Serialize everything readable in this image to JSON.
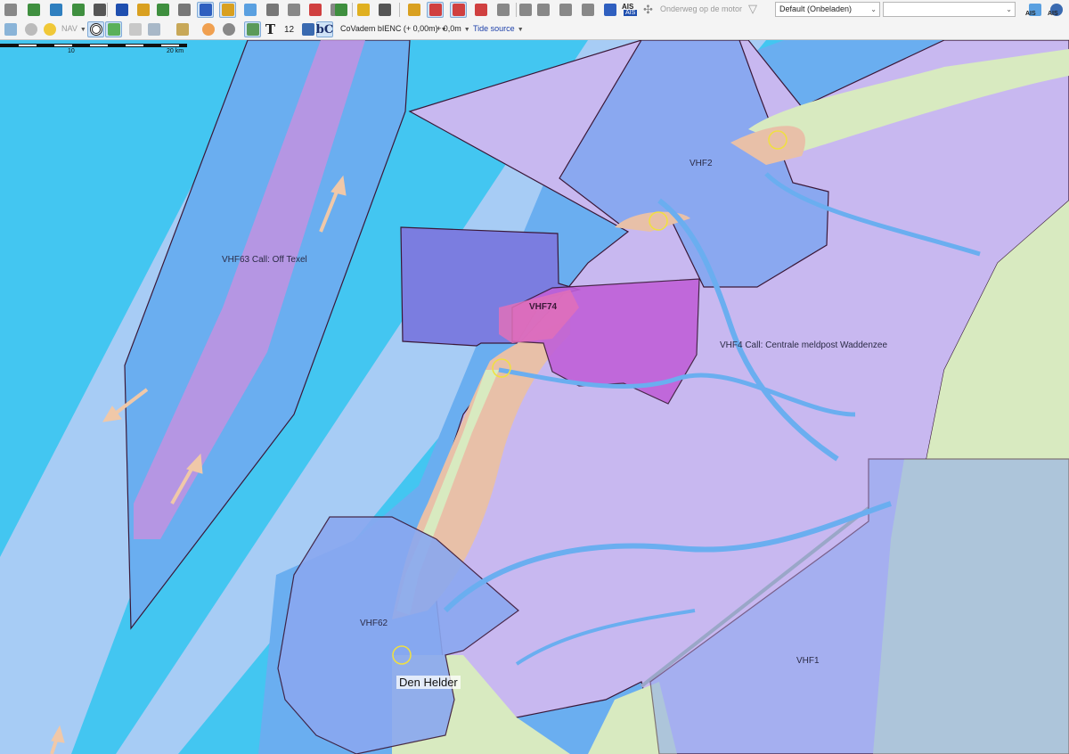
{
  "toolbar": {
    "row1_buttons": [
      {
        "name": "tools-icon",
        "color": "#888888",
        "active": false
      },
      {
        "name": "route-icon",
        "color": "#3f8f3f",
        "active": false
      },
      {
        "name": "link-icon",
        "color": "#2f7fbf",
        "active": false
      },
      {
        "name": "waypoint-icon",
        "color": "#3f8f3f",
        "active": false
      },
      {
        "name": "start-icon",
        "color": "#555555",
        "active": false
      },
      {
        "name": "xpl-icon",
        "color": "#1f4faf",
        "active": false
      },
      {
        "name": "star-icon",
        "color": "#d9a020",
        "active": false
      },
      {
        "name": "chart-icon",
        "color": "#3f8f3f",
        "active": false
      },
      {
        "name": "pen-icon",
        "color": "#777777",
        "active": false
      },
      {
        "name": "target-icon",
        "color": "#2f5fbf",
        "active": true
      },
      {
        "name": "tag-icon",
        "color": "#d9a020",
        "active": true
      },
      {
        "name": "mark-icon",
        "color": "#5aa0e0",
        "active": false
      },
      {
        "name": "edit-icon",
        "color": "#777777",
        "active": false
      },
      {
        "name": "layers-icon",
        "color": "#888888",
        "active": false
      },
      {
        "name": "pin-icon",
        "color": "#d04040",
        "active": false
      },
      {
        "name": "tag2-icon",
        "color": "#888888",
        "active": false
      },
      {
        "name": "grid-icon",
        "color": "#3f8f3f",
        "active": false
      },
      {
        "name": "warning-icon",
        "color": "#e0b020",
        "active": false
      },
      {
        "name": "steer-icon",
        "color": "#555555",
        "active": false
      },
      {
        "name": "traffic-icon",
        "color": "#d9a020",
        "active": false
      },
      {
        "name": "highlight-icon",
        "color": "#d04040",
        "active": true
      },
      {
        "name": "frame-icon",
        "color": "#d04040",
        "active": true
      },
      {
        "name": "flag-icon",
        "color": "#d04040",
        "active": false
      },
      {
        "name": "screen-icon",
        "color": "#888888",
        "active": false
      },
      {
        "name": "moon-icon",
        "color": "#888888",
        "active": false
      },
      {
        "name": "sound-icon",
        "color": "#888888",
        "active": false
      },
      {
        "name": "wrench-icon",
        "color": "#888888",
        "active": false
      },
      {
        "name": "search-icon",
        "color": "#888888",
        "active": false
      },
      {
        "name": "help-icon",
        "color": "#2f5fbf",
        "active": false
      }
    ],
    "ais_label": "AIS",
    "ais_sub": "AIS",
    "engine_label": "Onderweg op de motor",
    "profile_select": "Default (Onbeladen)",
    "empty_select": "",
    "nav_label": "NAV",
    "text_tool": "T",
    "number_tool": "12",
    "bc_tool": "bC",
    "chart_source": "CoVadem bIENC",
    "chart_offset": "(+ 0,00m)",
    "depth_offset": "+ 0,0m",
    "tide_source": "Tide source",
    "ais_right_top": "AIS",
    "ais_right_bottom": "AIS"
  },
  "map": {
    "scale": {
      "ticks": [
        "10",
        "20 km"
      ]
    },
    "zones": [
      {
        "id": "vhf63",
        "label": "VHF63 Call: Off Texel"
      },
      {
        "id": "vhf74",
        "label": "VHF74"
      },
      {
        "id": "vhf2",
        "label": "VHF2"
      },
      {
        "id": "vhf4",
        "label": "VHF4 Call: Centrale meldpost Waddenzee"
      },
      {
        "id": "vhf62",
        "label": "VHF62"
      },
      {
        "id": "vhf1",
        "label": "VHF1"
      }
    ],
    "city": "Den Helder",
    "colors": {
      "sea": "#43c6f1",
      "deep_sea": "#6aaef0",
      "vhf_zone": "#c8b8f0",
      "vhf74_zone": "#7b7de0",
      "land": "#d8eac0",
      "sand": "#e8c0a8",
      "zone_border": "#3a1838"
    }
  }
}
